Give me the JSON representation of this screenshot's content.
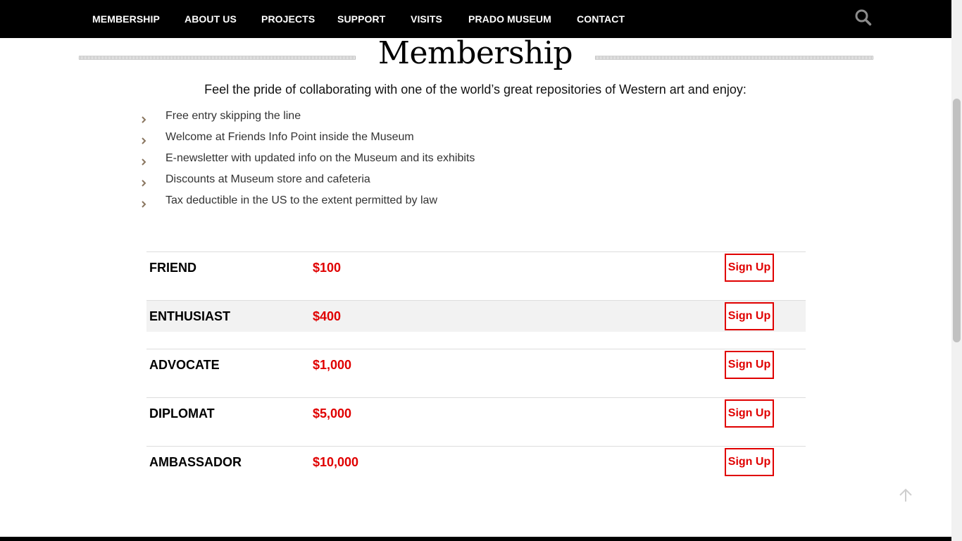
{
  "nav": {
    "items": [
      "MEMBERSHIP",
      "ABOUT US",
      "PROJECTS",
      "SUPPORT",
      "VISITS",
      "PRADO MUSEUM",
      "CONTACT"
    ],
    "search_icon": "search-icon"
  },
  "page": {
    "title": "Membership",
    "intro": "Feel the pride of collaborating with one of the world’s great repositories of Western art and enjoy:"
  },
  "benefits": [
    "Free entry skipping the line",
    "Welcome at Friends Info Point inside the Museum",
    "E-newsletter with updated info on the Museum and its exhibits",
    "Discounts at Museum store and cafeteria",
    "Tax deductible in the US to the extent permitted by law"
  ],
  "tiers": [
    {
      "name": "FRIEND",
      "price": "$100",
      "action": "Sign Up"
    },
    {
      "name": "ENTHUSIAST",
      "price": "$400",
      "action": "Sign Up"
    },
    {
      "name": "ADVOCATE",
      "price": "$1,000",
      "action": "Sign Up"
    },
    {
      "name": "DIPLOMAT",
      "price": "$5,000",
      "action": "Sign Up"
    },
    {
      "name": "AMBASSADOR",
      "price": "$10,000",
      "action": "Sign Up"
    }
  ],
  "colors": {
    "accent": "#e00000",
    "nav_bg": "#000000",
    "chevron": "#8a7660"
  },
  "icons": {
    "benefit_bullet": "chevron-right-icon",
    "back_to_top": "arrow-up-icon"
  }
}
